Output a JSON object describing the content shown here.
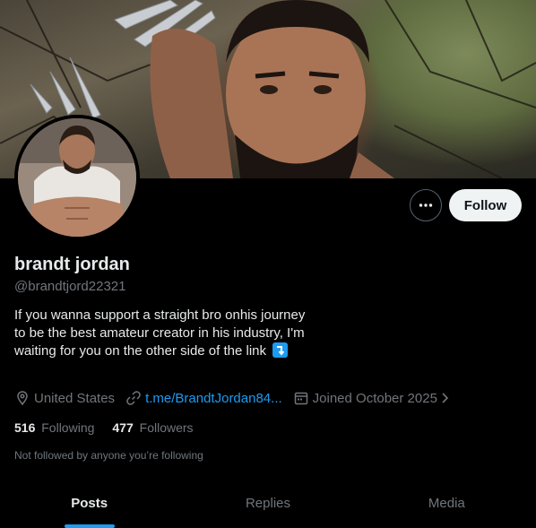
{
  "profile": {
    "display_name": "brandt jordan",
    "handle": "@brandtjord22321",
    "bio": "If you wanna support a straight bro onhis journey to be the best amateur creator in his industry, I'm waiting for you on the other side of the link",
    "bio_emoji": "right-arrow-curving-down-emoji",
    "location": "United States",
    "link": "t.me/BrandtJordan84...",
    "joined": "Joined October 2025",
    "following_count": "516",
    "following_label": "Following",
    "followers_count": "477",
    "followers_label": "Followers",
    "not_followed_text": "Not followed by anyone you’re following"
  },
  "actions": {
    "follow_label": "Follow",
    "more_icon": "more-dots-icon"
  },
  "tabs": [
    {
      "label": "Posts",
      "active": true
    },
    {
      "label": "Replies",
      "active": false
    },
    {
      "label": "Media",
      "active": false
    }
  ],
  "icons": {
    "location": "location-pin-icon",
    "link": "link-icon",
    "calendar": "calendar-icon",
    "chevron": "chevron-right-icon"
  },
  "colors": {
    "background": "#000000",
    "accent": "#1d9bf0",
    "text_primary": "#e7e9ea",
    "text_secondary": "#71767b",
    "follow_button_bg": "#eff3f4"
  }
}
